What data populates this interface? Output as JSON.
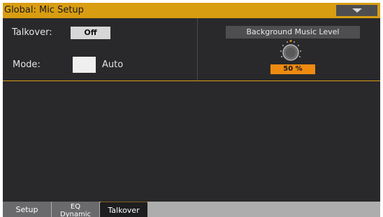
{
  "header": {
    "title": "Global: Mic Setup",
    "menu_icon": "triangle-down-icon"
  },
  "talkover": {
    "label": "Talkover:",
    "value": "Off"
  },
  "mode": {
    "label": "Mode:",
    "value": "Auto"
  },
  "background_music": {
    "label": "Background Music Level",
    "value": "50 %",
    "level": 0.5
  },
  "tabs": [
    {
      "label": "Setup"
    },
    {
      "line1": "EQ",
      "line2": "Dynamic"
    },
    {
      "label": "Talkover"
    }
  ],
  "colors": {
    "accent": "#d99d12",
    "value_box": "#ee8a10",
    "background": "#29292b"
  }
}
